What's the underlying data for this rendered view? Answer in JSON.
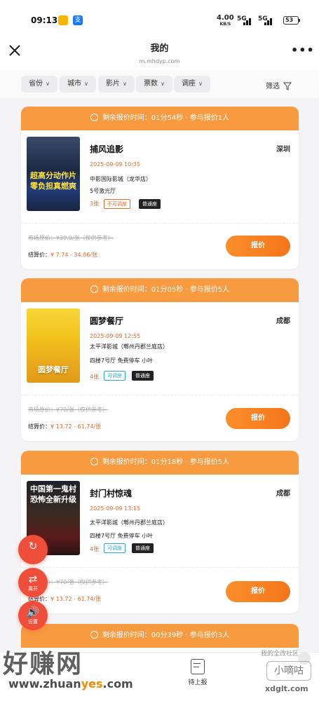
{
  "status_bar": {
    "time": "09:13",
    "app_icon_2": "支",
    "speed": "4.00",
    "speed_unit": "KB/S",
    "signal1": "5G",
    "signal2": "5G",
    "battery": "53"
  },
  "nav": {
    "title": "我的",
    "url": "m.mhdyp.com",
    "more": "•••"
  },
  "filters": [
    "省份",
    "城市",
    "影片",
    "票数",
    "调座"
  ],
  "filter_button": "筛选",
  "cards": [
    {
      "header": "剩余报价时间：01分54秒 · 参与报价1人",
      "movie": "捕风追影",
      "city": "深圳",
      "time": "2025-09-09 10:35",
      "cinema": "中影国际影城（龙华店）",
      "hall": "5号激光厅",
      "count": "3张",
      "tag1": "不可调座",
      "tag2": "普通座",
      "market_price": "市场原价：¥39.9/张（仅供参考）",
      "settle_label": "结算价：",
      "settle_value": "¥ 7.74 - 34.86/张",
      "button": "报价",
      "poster_text": "超高分动作片\n零负担真燃爽"
    },
    {
      "header": "剩余报价时间：01分05秒 · 参与报价5人",
      "movie": "圆梦餐厅",
      "city": "成都",
      "time": "2025-09-09 12:55",
      "cinema": "太平洋影城（郫州丹郡兰庭店）",
      "hall": "四楼7号厅 免费停车 小叶",
      "count": "4张",
      "tag1": "可调座",
      "tag2": "普通座",
      "market_price": "市场原价：¥70/张（仅供参考）",
      "settle_label": "结算价：",
      "settle_value": "¥ 13.72 - 61.74/张",
      "button": "报价",
      "poster_text": "圆梦餐厅"
    },
    {
      "header": "剩余报价时间：01分18秒 · 参与报价5人",
      "movie": "封门村惊魂",
      "city": "成都",
      "time": "2025-09-09 13:15",
      "cinema": "太平洋影城（郫州丹郡兰庭店）",
      "hall": "四楼7号厅 免费停车 小叶",
      "count": "4张",
      "tag1": "可调座",
      "tag2": "普通座",
      "market_price": "市场原价：¥70/张（仅供参考）",
      "settle_label": "结算价：",
      "settle_value": "¥ 13.72 - 61.74/张",
      "button": "报价",
      "poster_text": "中国第一鬼村\n恐怖全新升级"
    },
    {
      "header": "剩余报价时间：00分39秒 · 参与报价3人"
    }
  ],
  "fabs": [
    {
      "icon": "↻",
      "label": ""
    },
    {
      "icon": "⇄",
      "label": "离开"
    },
    {
      "icon": "🔊",
      "label": "设置"
    }
  ],
  "tabbar": {
    "tab2_label": "待上报"
  },
  "watermark": {
    "left_big": "好赚网",
    "url_pre": "www.zhuan",
    "url_mid": "yes",
    "url_post": ".com",
    "right_top": "我的全改社区",
    "right_logo": "小嘀咕",
    "right_bottom": "xdglt.com"
  },
  "colors": {
    "accent": "#f79a40",
    "button": "#f4761a",
    "fab": "#ef4f3a"
  }
}
